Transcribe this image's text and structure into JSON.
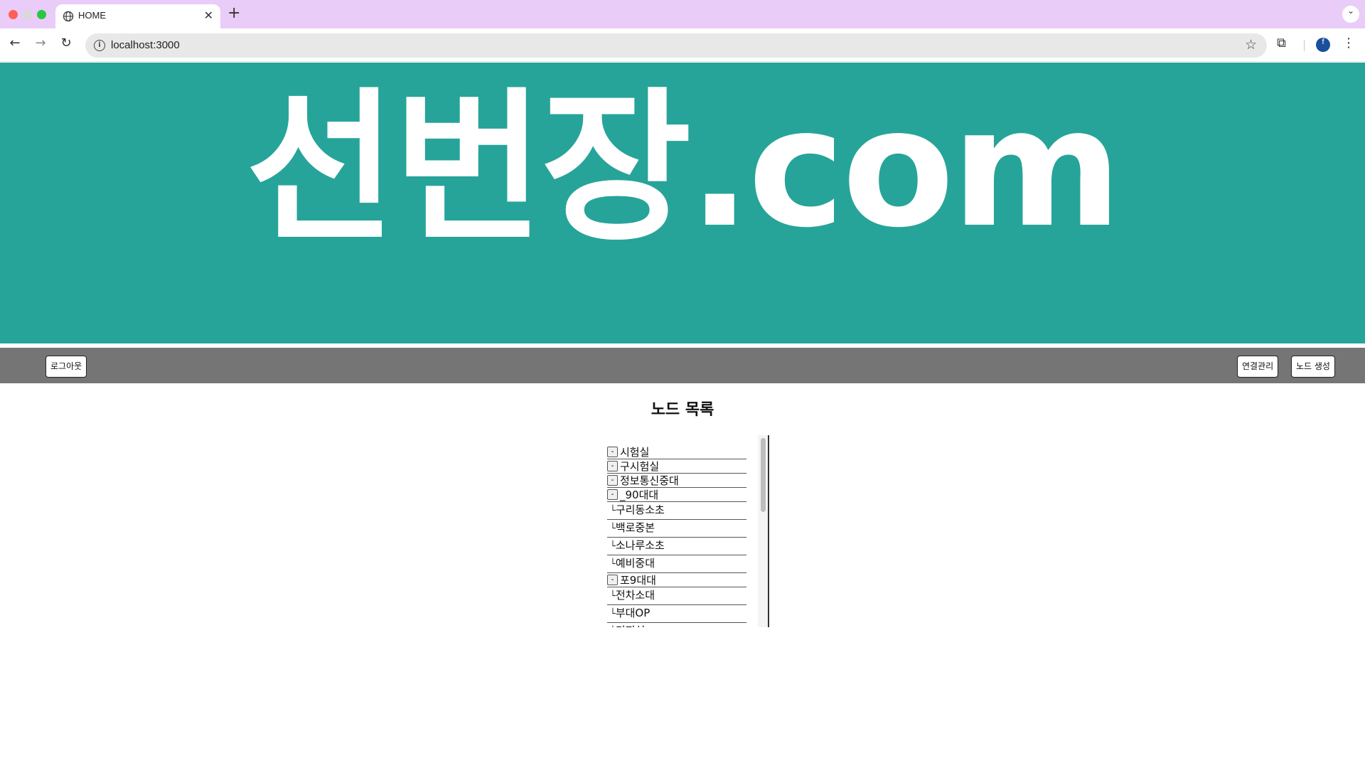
{
  "browser": {
    "tab_title": "HOME",
    "tab_close": "✕",
    "new_tab": "+",
    "tab_menu": "⌄",
    "url": "localhost:3000",
    "back": "←",
    "forward": "→",
    "reload": "↻",
    "star": "☆",
    "profile_initial": "f",
    "menu": "⋮",
    "extensions": "⧉",
    "info": "i"
  },
  "banner": {
    "title": "선번장.com"
  },
  "nav": {
    "logout_label": "로그아웃",
    "connection_label": "연결관리",
    "create_label": "노드 생성"
  },
  "node_list": {
    "title": "노드 목록",
    "toggle_symbol": "-",
    "branch_symbol": "└",
    "items": [
      {
        "label": "시험실",
        "kind": "parent"
      },
      {
        "label": "구시험실",
        "kind": "parent"
      },
      {
        "label": "정보통신중대",
        "kind": "parent"
      },
      {
        "label": "_90대대",
        "kind": "parent"
      },
      {
        "label": "구리동소초",
        "kind": "child"
      },
      {
        "label": "백로중본",
        "kind": "child"
      },
      {
        "label": "소나루소초",
        "kind": "child"
      },
      {
        "label": "예비중대",
        "kind": "child"
      },
      {
        "label": "포9대대",
        "kind": "parent"
      },
      {
        "label": "전차소대",
        "kind": "child"
      },
      {
        "label": "부대OP",
        "kind": "child"
      },
      {
        "label": "기지실",
        "kind": "child"
      }
    ]
  }
}
